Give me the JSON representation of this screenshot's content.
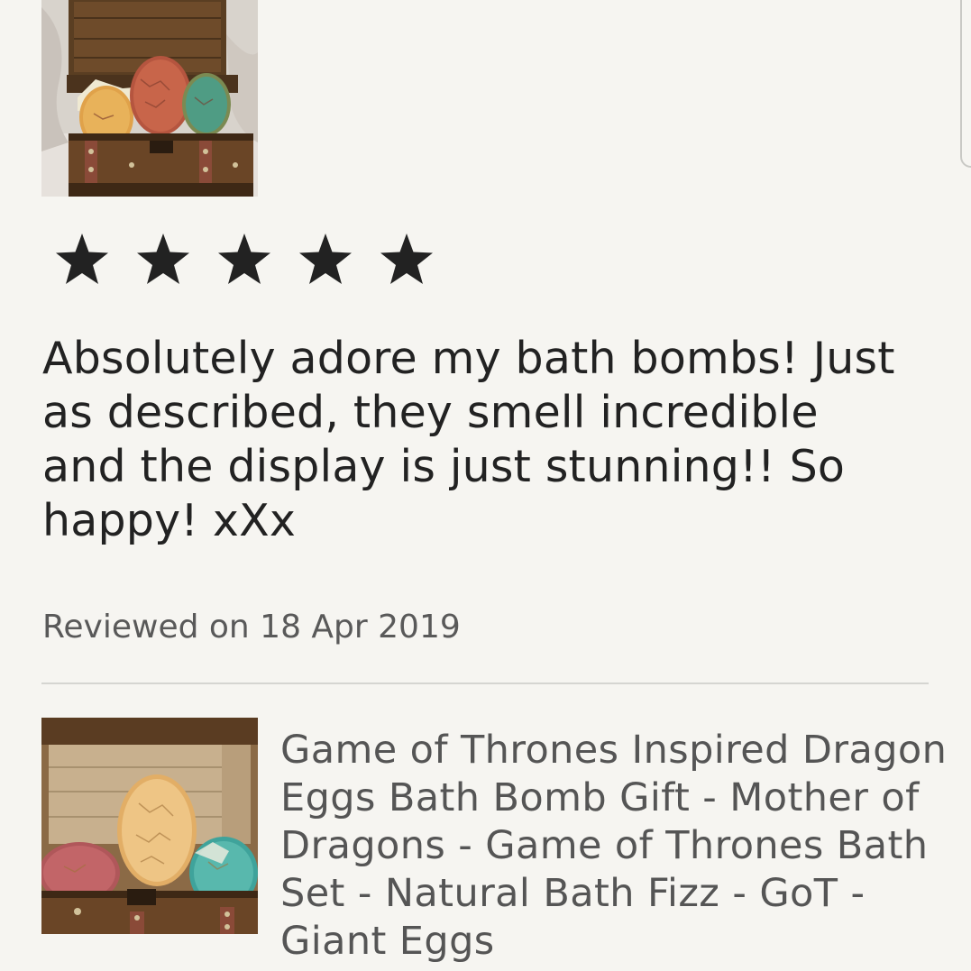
{
  "review": {
    "photo_icon": "dragon-eggs-chest-photo",
    "rating": 5,
    "rating_max": 5,
    "star_color": "#222222",
    "text": "Absolutely adore my bath bombs! Just as described, they smell incredible and the display is just stunning!! So happy! xXx",
    "date": "Reviewed on 18 Apr 2019"
  },
  "listing": {
    "photo_icon": "dragon-eggs-chest-photo",
    "title": "Game of Thrones Inspired Dragon Eggs Bath Bomb Gift - Mother of Dragons - Game of Thrones Bath Set - Natural Bath Fizz - GoT - Giant Eggs"
  },
  "colors": {
    "background": "#f6f5f1",
    "text_primary": "#222222",
    "text_secondary": "#595959",
    "divider": "#d5d5d1"
  }
}
